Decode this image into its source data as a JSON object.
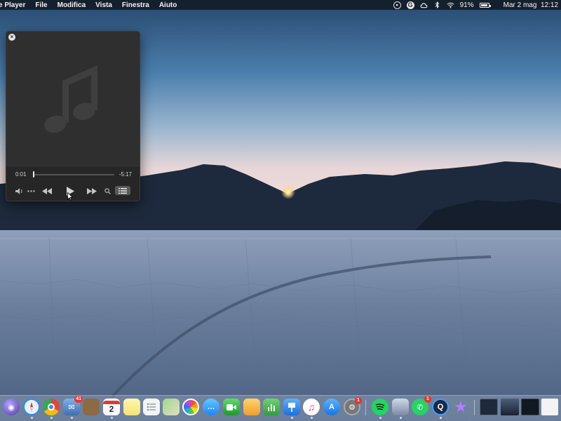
{
  "menubar": {
    "app_name": "e Player",
    "menus": [
      "File",
      "Modifica",
      "Vista",
      "Finestra",
      "Aiuto"
    ],
    "battery_percent": "91%",
    "datetime": "Mar 2 mag  12:12"
  },
  "player": {
    "elapsed": "0:01",
    "remaining": "-5:17",
    "progress_fraction": 0.01
  },
  "dock": {
    "calendar_day": "2",
    "badges": {
      "mail": "41",
      "preferences": "1",
      "whatsapp": "1"
    }
  }
}
